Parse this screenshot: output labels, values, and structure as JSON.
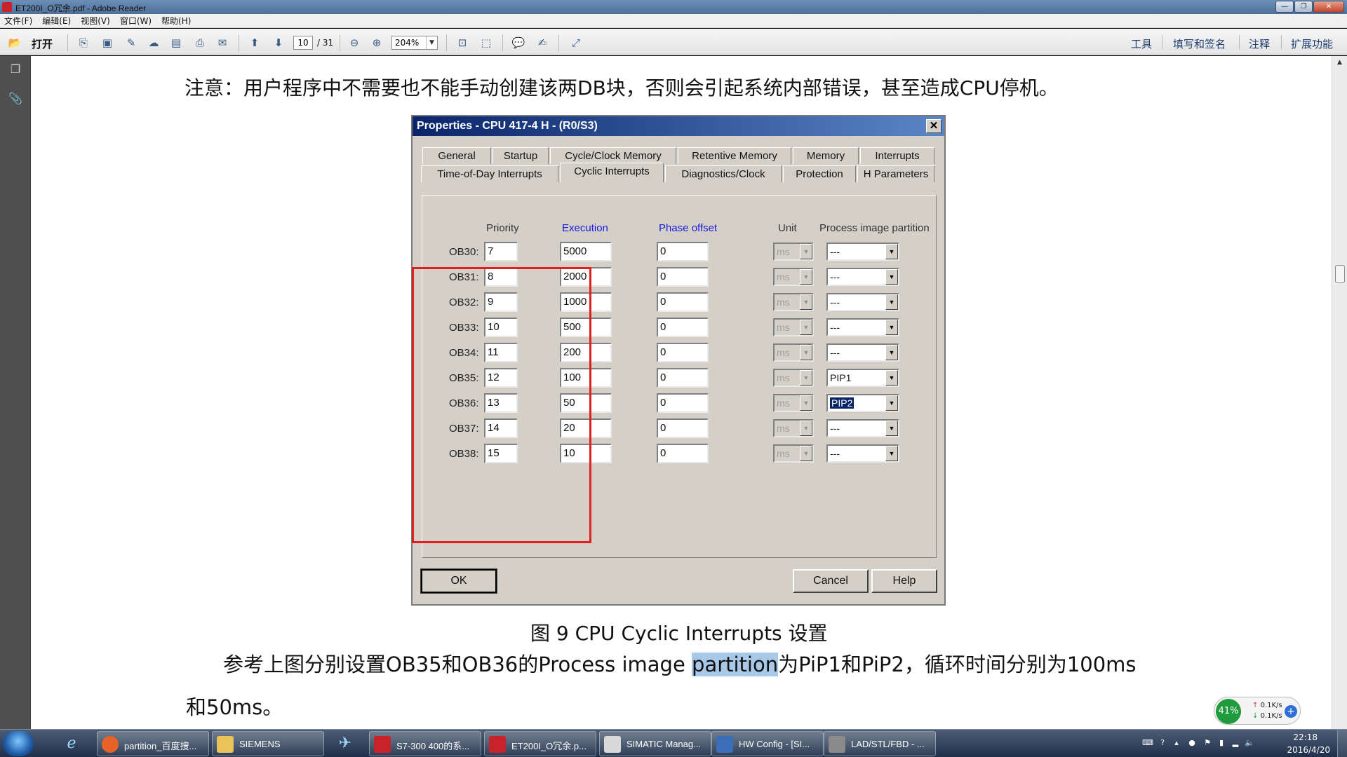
{
  "window": {
    "title": "ET200I_O冗余.pdf - Adobe Reader"
  },
  "menu": [
    "文件(F)",
    "编辑(E)",
    "视图(V)",
    "窗口(W)",
    "帮助(H)"
  ],
  "toolbar": {
    "open_label": "打开",
    "page_current": "10",
    "page_total": "/ 31",
    "zoom": "204%",
    "right_links": [
      "工具",
      "填写和签名",
      "注释",
      "扩展功能"
    ]
  },
  "document": {
    "notice": "注意：用户程序中不需要也不能手动创建该两DB块，否则会引起系统内部错误，甚至造成CPU停机。",
    "caption": "图 9 CPU Cyclic Interrupts 设置",
    "desc_pre": "参考上图分别设置OB35和OB36的Process image ",
    "desc_highlight": "partition",
    "desc_post": "为PiP1和PiP2，循环时间分别为100ms",
    "desc_line2": "和50ms。"
  },
  "dialog": {
    "title": "Properties - CPU 417-4 H - (R0/S3)",
    "close": "✕",
    "tabs_row1": [
      "General",
      "Startup",
      "Cycle/Clock Memory",
      "Retentive Memory",
      "Memory",
      "Interrupts"
    ],
    "tabs_row2": [
      "Time-of-Day Interrupts",
      "Cyclic Interrupts",
      "Diagnostics/Clock",
      "Protection",
      "H Parameters"
    ],
    "active_tab": "Cyclic Interrupts",
    "headers": {
      "priority": "Priority",
      "execution": "Execution",
      "phase": "Phase offset",
      "unit": "Unit",
      "pip": "Process image partition"
    },
    "rows": [
      {
        "ob": "OB30:",
        "priority": "7",
        "execution": "5000",
        "phase": "0",
        "unit": "ms",
        "pip": "---"
      },
      {
        "ob": "OB31:",
        "priority": "8",
        "execution": "2000",
        "phase": "0",
        "unit": "ms",
        "pip": "---"
      },
      {
        "ob": "OB32:",
        "priority": "9",
        "execution": "1000",
        "phase": "0",
        "unit": "ms",
        "pip": "---"
      },
      {
        "ob": "OB33:",
        "priority": "10",
        "execution": "500",
        "phase": "0",
        "unit": "ms",
        "pip": "---"
      },
      {
        "ob": "OB34:",
        "priority": "11",
        "execution": "200",
        "phase": "0",
        "unit": "ms",
        "pip": "---"
      },
      {
        "ob": "OB35:",
        "priority": "12",
        "execution": "100",
        "phase": "0",
        "unit": "ms",
        "pip": "PIP1"
      },
      {
        "ob": "OB36:",
        "priority": "13",
        "execution": "50",
        "phase": "0",
        "unit": "ms",
        "pip": "PIP2"
      },
      {
        "ob": "OB37:",
        "priority": "14",
        "execution": "20",
        "phase": "0",
        "unit": "ms",
        "pip": "---"
      },
      {
        "ob": "OB38:",
        "priority": "15",
        "execution": "10",
        "phase": "0",
        "unit": "ms",
        "pip": "---"
      }
    ],
    "buttons": {
      "ok": "OK",
      "cancel": "Cancel",
      "help": "Help"
    }
  },
  "net_widget": {
    "percent": "41%",
    "up": "0.1K/s",
    "down": "0.1K/s",
    "plus": "+"
  },
  "taskbar": {
    "tasks": [
      {
        "label": "partition_百度搜...",
        "color": "#e8632a"
      },
      {
        "label": "SIEMENS",
        "color": "#e9c35a"
      },
      {
        "label": "S7-300 400的系...",
        "color": "#c8232a"
      },
      {
        "label": "ET200I_O冗余.p...",
        "color": "#c8232a"
      },
      {
        "label": "SIMATIC Manag...",
        "color": "#d8d8d8"
      },
      {
        "label": "HW Config - [SI...",
        "color": "#3a6fb8"
      },
      {
        "label": "LAD/STL/FBD - ...",
        "color": "#8a8a8a"
      }
    ],
    "clock_time": "22:18",
    "clock_date": "2016/4/20"
  },
  "colors": {
    "highlight_box": "#e02020",
    "dialog_title": "#0a246a",
    "selection": "#0a246a"
  }
}
